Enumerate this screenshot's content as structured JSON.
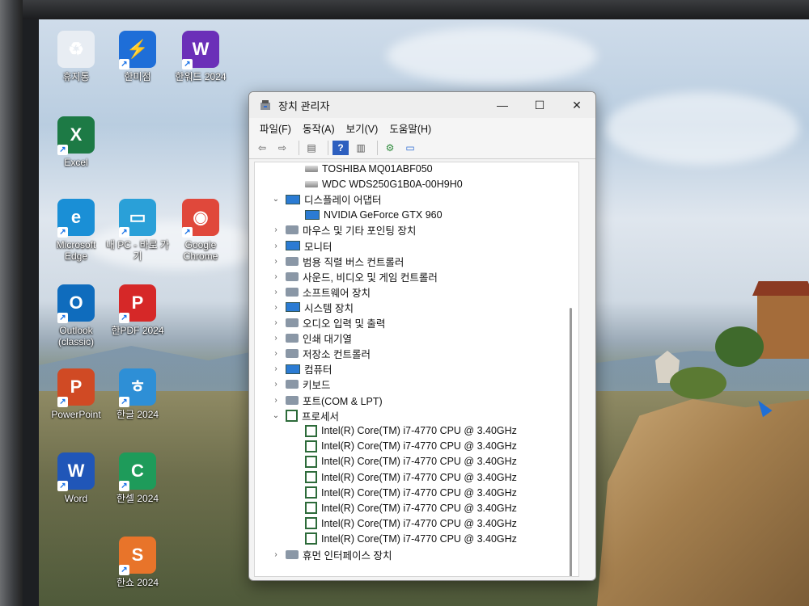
{
  "desktop": {
    "icons": [
      {
        "label": "휴지통",
        "icon": "recycle-bin-icon",
        "color": "#e8edf3"
      },
      {
        "label": "한미점",
        "icon": "lightning-app-icon",
        "color": "#1e6ed8"
      },
      {
        "label": "한워드 2024",
        "icon": "hanword-icon",
        "color": "#6b2fb8"
      },
      {
        "label": "Excel",
        "icon": "excel-icon",
        "color": "#1d7a45"
      },
      {
        "label": "Microsoft Edge",
        "icon": "edge-icon",
        "color": "#1a8fd6"
      },
      {
        "label": "내 PC - 바로 가기",
        "icon": "this-pc-icon",
        "color": "#2aa0d8"
      },
      {
        "label": "Google Chrome",
        "icon": "chrome-icon",
        "color": "#e0483b"
      },
      {
        "label": "Outlook (classic)",
        "icon": "outlook-icon",
        "color": "#0f6cbd"
      },
      {
        "label": "한PDF 2024",
        "icon": "hanpdf-icon",
        "color": "#d62828"
      },
      {
        "label": "PowerPoint",
        "icon": "powerpoint-icon",
        "color": "#d04a24"
      },
      {
        "label": "한글 2024",
        "icon": "hangul-icon",
        "color": "#2e8fd6"
      },
      {
        "label": "Word",
        "icon": "word-icon",
        "color": "#2056b8"
      },
      {
        "label": "한셀 2024",
        "icon": "hancell-icon",
        "color": "#1e9b5a"
      },
      {
        "label": "한쇼 2024",
        "icon": "hanshow-icon",
        "color": "#e8742a"
      }
    ],
    "icon_glyphs": [
      "♻",
      "⚡",
      "W",
      "X",
      "e",
      "▭",
      "◉",
      "O",
      "P",
      "P",
      "ㅎ",
      "W",
      "C",
      "S"
    ]
  },
  "window": {
    "title": "장치 관리자",
    "controls": {
      "minimize": "—",
      "maximize": "☐",
      "close": "✕"
    },
    "menu": [
      "파일(F)",
      "동작(A)",
      "보기(V)",
      "도움말(H)"
    ],
    "toolbar_icons": [
      "back-arrow-icon",
      "forward-arrow-icon",
      "properties-icon",
      "help-icon",
      "view-icon",
      "scan-hardware-icon",
      "monitor-icon"
    ],
    "toolbar_glyphs": [
      "⇦",
      "⇨",
      "▤",
      "?",
      "▥",
      "⚙",
      "▭"
    ],
    "tree": [
      {
        "label": "TOSHIBA MQ01ABF050",
        "indent": 2,
        "chevron": "",
        "icon": "disk"
      },
      {
        "label": "WDC WDS250G1B0A-00H9H0",
        "indent": 2,
        "chevron": "",
        "icon": "disk"
      },
      {
        "label": "디스플레이 어댑터",
        "indent": 1,
        "chevron": "⌄",
        "icon": "mon"
      },
      {
        "label": "NVIDIA GeForce GTX 960",
        "indent": 2,
        "chevron": "",
        "icon": "mon"
      },
      {
        "label": "마우스 및 기타 포인팅 장치",
        "indent": 1,
        "chevron": "›",
        "icon": "gen"
      },
      {
        "label": "모니터",
        "indent": 1,
        "chevron": "›",
        "icon": "mon"
      },
      {
        "label": "범용 직렬 버스 컨트롤러",
        "indent": 1,
        "chevron": "›",
        "icon": "gen"
      },
      {
        "label": "사운드, 비디오 및 게임 컨트롤러",
        "indent": 1,
        "chevron": "›",
        "icon": "gen"
      },
      {
        "label": "소프트웨어 장치",
        "indent": 1,
        "chevron": "›",
        "icon": "gen"
      },
      {
        "label": "시스템 장치",
        "indent": 1,
        "chevron": "›",
        "icon": "mon"
      },
      {
        "label": "오디오 입력 및 출력",
        "indent": 1,
        "chevron": "›",
        "icon": "gen"
      },
      {
        "label": "인쇄 대기열",
        "indent": 1,
        "chevron": "›",
        "icon": "gen"
      },
      {
        "label": "저장소 컨트롤러",
        "indent": 1,
        "chevron": "›",
        "icon": "gen"
      },
      {
        "label": "컴퓨터",
        "indent": 1,
        "chevron": "›",
        "icon": "mon"
      },
      {
        "label": "키보드",
        "indent": 1,
        "chevron": "›",
        "icon": "gen"
      },
      {
        "label": "포트(COM & LPT)",
        "indent": 1,
        "chevron": "›",
        "icon": "gen"
      },
      {
        "label": "프로세서",
        "indent": 1,
        "chevron": "⌄",
        "icon": "proc"
      },
      {
        "label": "Intel(R) Core(TM) i7-4770 CPU @ 3.40GHz",
        "indent": 2,
        "chevron": "",
        "icon": "proc"
      },
      {
        "label": "Intel(R) Core(TM) i7-4770 CPU @ 3.40GHz",
        "indent": 2,
        "chevron": "",
        "icon": "proc"
      },
      {
        "label": "Intel(R) Core(TM) i7-4770 CPU @ 3.40GHz",
        "indent": 2,
        "chevron": "",
        "icon": "proc"
      },
      {
        "label": "Intel(R) Core(TM) i7-4770 CPU @ 3.40GHz",
        "indent": 2,
        "chevron": "",
        "icon": "proc"
      },
      {
        "label": "Intel(R) Core(TM) i7-4770 CPU @ 3.40GHz",
        "indent": 2,
        "chevron": "",
        "icon": "proc"
      },
      {
        "label": "Intel(R) Core(TM) i7-4770 CPU @ 3.40GHz",
        "indent": 2,
        "chevron": "",
        "icon": "proc"
      },
      {
        "label": "Intel(R) Core(TM) i7-4770 CPU @ 3.40GHz",
        "indent": 2,
        "chevron": "",
        "icon": "proc"
      },
      {
        "label": "Intel(R) Core(TM) i7-4770 CPU @ 3.40GHz",
        "indent": 2,
        "chevron": "",
        "icon": "proc"
      },
      {
        "label": "휴먼 인터페이스 장치",
        "indent": 1,
        "chevron": "›",
        "icon": "gen"
      }
    ]
  }
}
